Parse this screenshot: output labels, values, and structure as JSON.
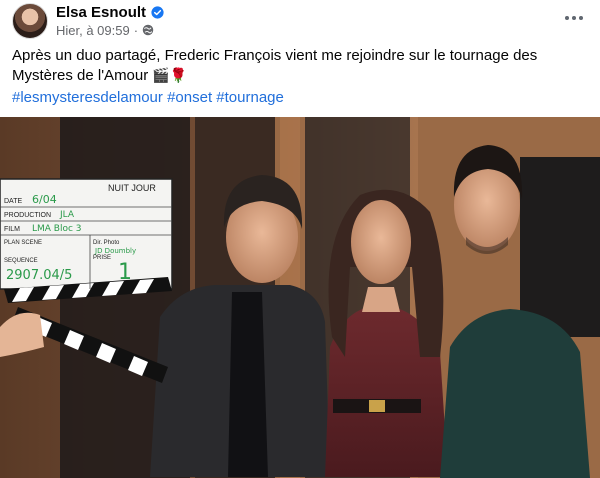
{
  "post": {
    "author": "Elsa Esnoult",
    "timestamp": "Hier, à 09:59",
    "separator": "·",
    "text": "Après un duo partagé, Frederic François vient me rejoindre sur le tournage des Mystères de l'Amour",
    "emojis": "🎬🌹",
    "hashtags": [
      "#lesmysteresdelamour",
      "#onset",
      "#tournage"
    ]
  },
  "clapperboard": {
    "title": "NUIT JOUR",
    "labels": [
      "DATE",
      "PRODUCTION",
      "FILM",
      "PLAN SCENE",
      "SEQUENCE",
      "Dir. Photo",
      "PRISE"
    ],
    "values": {
      "date": "6/04",
      "production": "JLA",
      "film": "LMA Bloc 3",
      "dir_photo": "JD Doumbly",
      "sequence": "2907.04/5",
      "prise": "1"
    }
  },
  "colors": {
    "link": "#216fdb",
    "verified": "#1877f2",
    "meta": "#65676b"
  },
  "icons": {
    "verified": "verified-badge-icon",
    "privacy": "globe-icon",
    "menu": "more-options-icon"
  }
}
